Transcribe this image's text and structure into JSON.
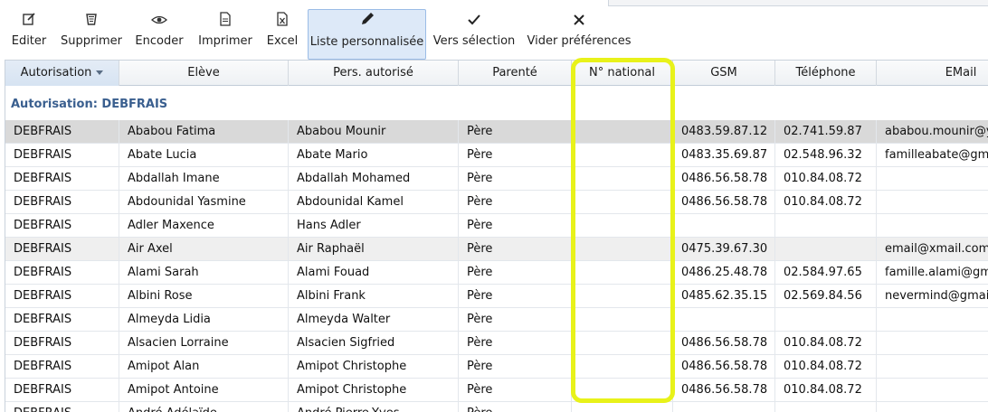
{
  "toolbar": {
    "items": [
      {
        "label": "Editer",
        "icon": "edit-icon",
        "glyph": "✎"
      },
      {
        "label": "Supprimer",
        "icon": "trash-icon",
        "glyph": "🗑"
      },
      {
        "label": "Encoder",
        "icon": "eye-icon",
        "glyph": "◉"
      },
      {
        "label": "Imprimer",
        "icon": "print-icon",
        "glyph": "▤"
      },
      {
        "label": "Excel",
        "icon": "excel-icon",
        "glyph": "▣"
      },
      {
        "label": "Liste personnalisée",
        "icon": "pencil-icon",
        "glyph": "✏"
      },
      {
        "label": "Vers sélection",
        "icon": "check-icon",
        "glyph": "✓"
      },
      {
        "label": "Vider préférences",
        "icon": "close-icon",
        "glyph": "✕"
      }
    ]
  },
  "grid": {
    "columns": [
      "Autorisation",
      "Elève",
      "Pers. autorisé",
      "Parenté",
      "N° national",
      "GSM",
      "Téléphone",
      "EMail"
    ],
    "group_label": "Autorisation: DEBFRAIS",
    "rows": [
      [
        "DEBFRAIS",
        "Ababou Fatima",
        "Ababou Mounir",
        "Père",
        "",
        "0483.59.87.12",
        "02.741.59.87",
        "ababou.mounir@yahoo"
      ],
      [
        "DEBFRAIS",
        "Abate Lucia",
        "Abate Mario",
        "Père",
        "",
        "0483.35.69.87",
        "02.548.96.32",
        "familleabate@gmail"
      ],
      [
        "DEBFRAIS",
        "Abdallah Imane",
        "Abdallah Mohamed",
        "Père",
        "",
        "0486.56.58.78",
        "010.84.08.72",
        ""
      ],
      [
        "DEBFRAIS",
        "Abdounidal Yasmine",
        "Abdounidal Kamel",
        "Père",
        "",
        "0486.56.58.78",
        "010.84.08.72",
        ""
      ],
      [
        "DEBFRAIS",
        "Adler Maxence",
        "Hans Adler",
        "Père",
        "",
        "",
        "",
        ""
      ],
      [
        "DEBFRAIS",
        "Air Axel",
        "Air Raphaël",
        "Père",
        "",
        "0475.39.67.30",
        "",
        "email@xmail.com"
      ],
      [
        "DEBFRAIS",
        "Alami Sarah",
        "Alami Fouad",
        "Père",
        "",
        "0486.25.48.78",
        "02.584.97.65",
        "famille.alami@gmail"
      ],
      [
        "DEBFRAIS",
        "Albini Rose",
        "Albini Frank",
        "Père",
        "",
        "0485.62.35.15",
        "02.569.84.56",
        "nevermind@gmail.com"
      ],
      [
        "DEBFRAIS",
        "Almeyda Lidia",
        "Almeyda Walter",
        "Père",
        "",
        "",
        "",
        ""
      ],
      [
        "DEBFRAIS",
        "Alsacien Lorraine",
        "Alsacien Sigfried",
        "Père",
        "",
        "0486.56.58.78",
        "010.84.08.72",
        ""
      ],
      [
        "DEBFRAIS",
        "Amipot Alan",
        "Amipot Christophe",
        "Père",
        "",
        "0486.56.58.78",
        "010.84.08.72",
        ""
      ],
      [
        "DEBFRAIS",
        "Amipot Antoine",
        "Amipot Christophe",
        "Père",
        "",
        "0486.56.58.78",
        "010.84.08.72",
        ""
      ],
      [
        "DEBFRAIS",
        "André Adélaïde",
        "André Pierre-Yves",
        "Père",
        "",
        "",
        "",
        ""
      ]
    ]
  },
  "colors": {
    "highlight": "#e8f21a",
    "group_text": "#3a5f8f",
    "selected_row": "#d9d9d9",
    "active_button": "#dde9f8"
  }
}
